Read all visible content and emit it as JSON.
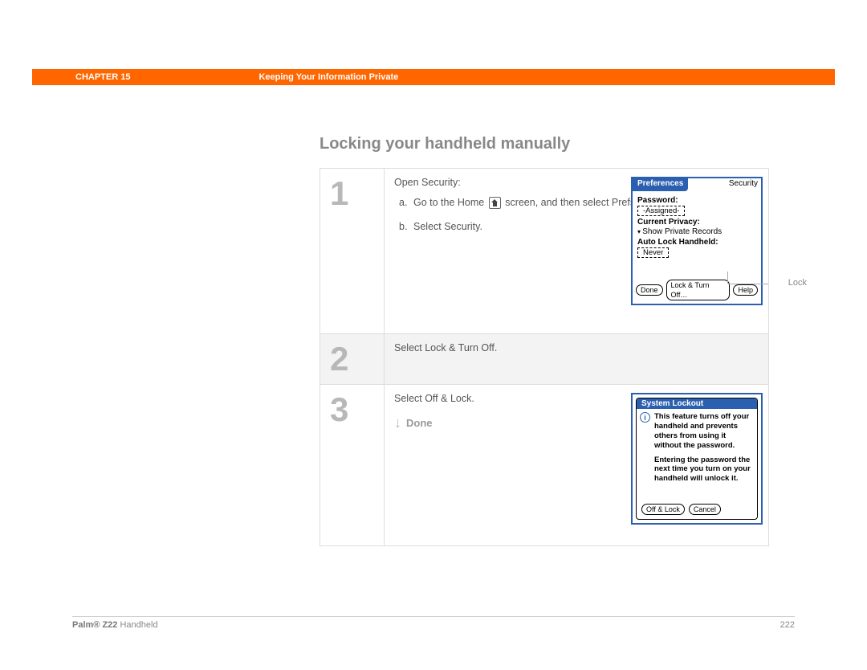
{
  "header": {
    "chapter": "CHAPTER 15",
    "title": "Keeping Your Information Private"
  },
  "heading": "Locking your handheld manually",
  "steps": {
    "s1": {
      "num": "1",
      "intro": "Open Security:",
      "a_letter": "a.",
      "a_text_pre": "Go to the Home ",
      "a_text_mid": " screen, and then select Prefs ",
      "a_text_post": ".",
      "b_letter": "b.",
      "b_text": "Select Security."
    },
    "s2": {
      "num": "2",
      "text": "Select Lock & Turn Off."
    },
    "s3": {
      "num": "3",
      "text": "Select Off & Lock.",
      "done_label": "Done"
    }
  },
  "palm1": {
    "tab": "Preferences",
    "category": "Security",
    "password_label": "Password:",
    "password_value": "-Assigned-",
    "privacy_label": "Current Privacy:",
    "privacy_value": "Show Private Records",
    "autolock_label": "Auto Lock Handheld:",
    "autolock_value": "Never",
    "btn_done": "Done",
    "btn_lockoff": "Lock & Turn Off…",
    "btn_help": "Help",
    "callout": "Lock"
  },
  "palm2": {
    "title": "System Lockout",
    "para1": "This feature turns off your handheld and prevents others from using it without the password.",
    "para2": "Entering the password the next time you turn on your handheld will unlock it.",
    "btn_lock": "Off & Lock",
    "btn_cancel": "Cancel"
  },
  "footer": {
    "brand_bold": "Palm® Z22",
    "brand_rest": " Handheld",
    "page": "222"
  }
}
